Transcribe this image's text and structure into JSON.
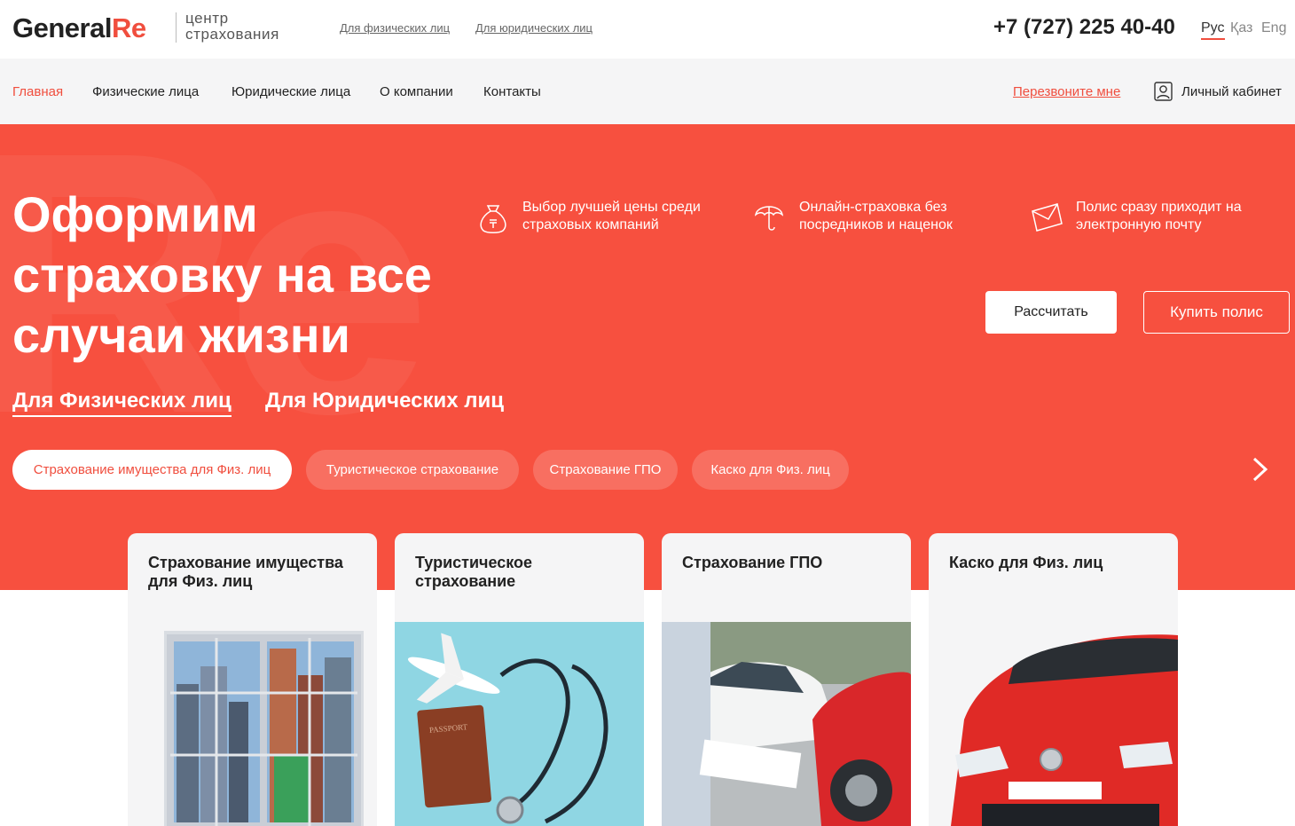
{
  "brand": {
    "name_main": "General",
    "name_accent": "Re",
    "subtitle_line1": "центр",
    "subtitle_line2": "страхования",
    "accent_color": "#f04e3e",
    "hero_color": "#f7503f"
  },
  "top_links": {
    "individuals": "Для физических лиц",
    "legal": "Для юридических лиц"
  },
  "phone": "+7 (727) 225 40-40",
  "languages": [
    {
      "label": "Рус",
      "active": true
    },
    {
      "label": "Қаз",
      "active": false
    },
    {
      "label": "Eng",
      "active": false
    }
  ],
  "nav": {
    "items": [
      "Главная",
      "Физические лица",
      "Юридические лица",
      "О компании",
      "Контакты"
    ],
    "callback": "Перезвоните мне",
    "cabinet": "Личный кабинет"
  },
  "hero": {
    "title": "Оформим страховку на все случаи жизни",
    "features": [
      {
        "icon": "money-bag-icon",
        "text": "Выбор лучшей цены среди страховых компаний"
      },
      {
        "icon": "umbrella-icon",
        "text": "Онлайн-страховка без посредников и наценок"
      },
      {
        "icon": "envelope-icon",
        "text": "Полис сразу приходит на электронную почту"
      }
    ],
    "calculate_button": "Рассчитать",
    "buy_button": "Купить полис",
    "segment_tabs": [
      "Для Физических лиц",
      "Для Юридических лиц"
    ],
    "chips": [
      "Страхование имущества для Физ. лиц",
      "Туристическое страхование",
      "Страхование ГПО",
      "Каско для Физ. лиц"
    ]
  },
  "cards": [
    {
      "title": "Страхование имущества для Физ. лиц",
      "image": "city-window-image"
    },
    {
      "title": "Туристическое страхование",
      "image": "passport-plane-image"
    },
    {
      "title": "Страхование ГПО",
      "image": "car-accident-image"
    },
    {
      "title": "Каско для Физ. лиц",
      "image": "red-car-image"
    }
  ]
}
